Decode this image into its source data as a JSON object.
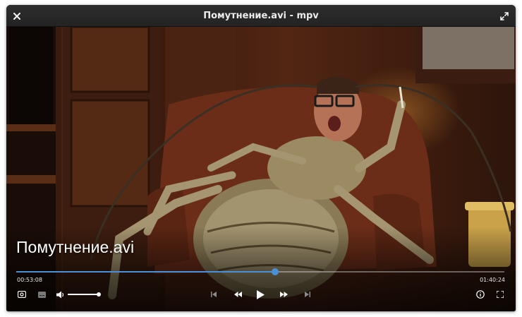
{
  "window": {
    "title": "Помутнение.avi - mpv"
  },
  "osd": {
    "media_title": "Помутнение.avi"
  },
  "playback": {
    "elapsed": "00:53:08",
    "duration": "01:40:24",
    "position_fraction": 0.53,
    "volume_fraction": 1.0,
    "accent_color": "#4a90d9"
  },
  "controls": {
    "left": [
      "audio-track-icon",
      "subtitles-icon",
      "volume-icon"
    ],
    "center": [
      "skip-previous-icon",
      "rewind-icon",
      "play-icon",
      "fast-forward-icon",
      "skip-next-icon"
    ],
    "right": [
      "info-icon",
      "fullscreen-icon"
    ]
  }
}
